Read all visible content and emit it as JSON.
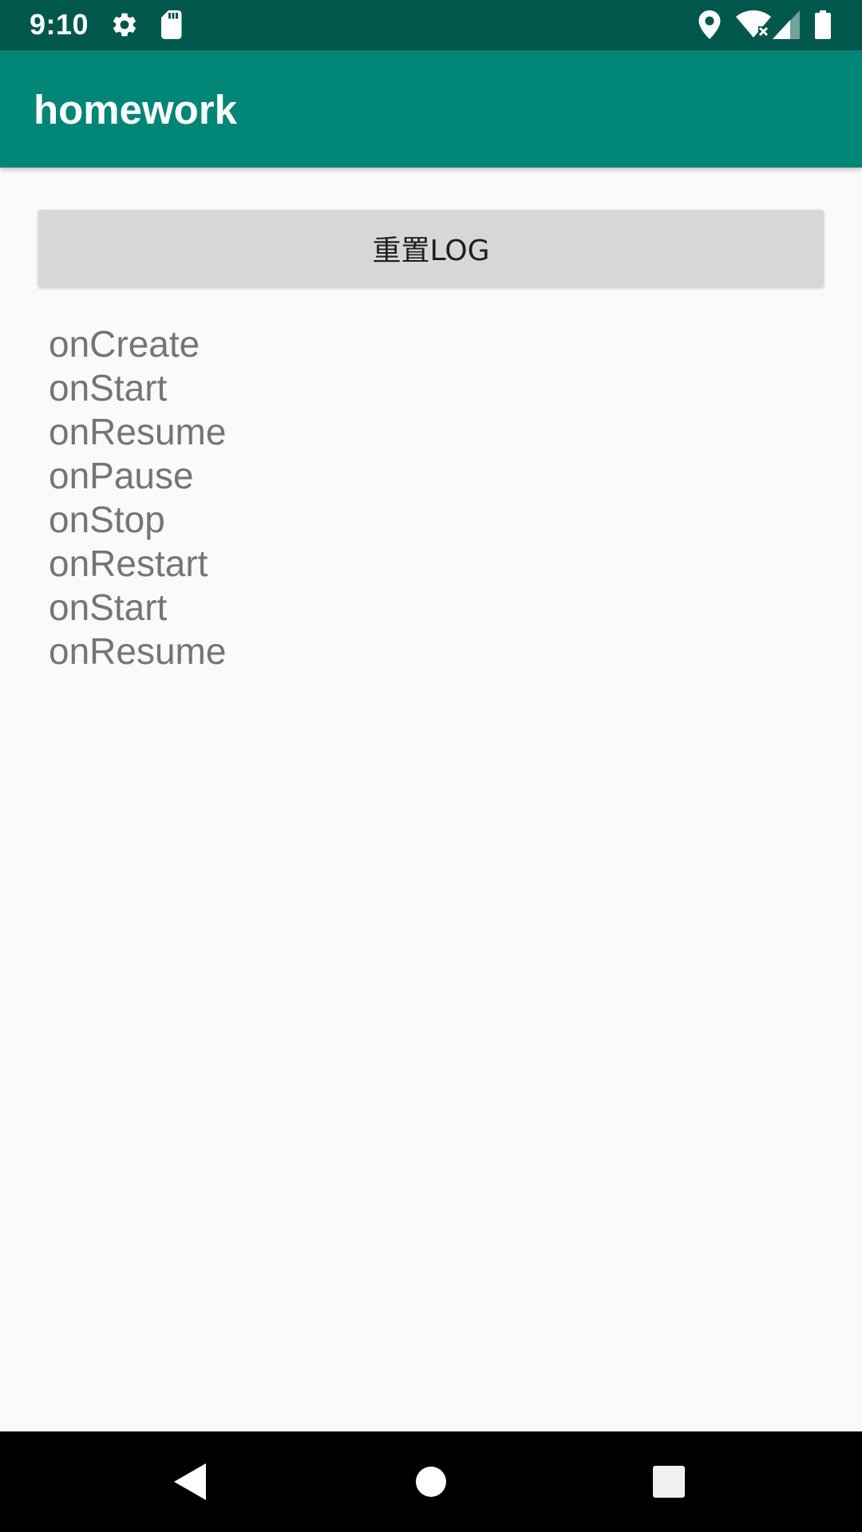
{
  "status_bar": {
    "time": "9:10",
    "icons": [
      "settings-icon",
      "sd-card-icon",
      "location-icon",
      "wifi-icon",
      "cell-signal-icon",
      "battery-icon"
    ]
  },
  "app_bar": {
    "title": "homework"
  },
  "main": {
    "reset_button_label": "重置LOG",
    "log_lines": [
      "onCreate",
      "onStart",
      "onResume",
      "onPause",
      "onStop",
      "onRestart",
      "onStart",
      "onResume"
    ]
  },
  "nav_bar": {
    "buttons": [
      "back-icon",
      "home-icon",
      "recents-icon"
    ]
  },
  "colors": {
    "status_bar": "#00574b",
    "app_bar": "#008577",
    "background": "#fafafa",
    "button": "#d6d7d7",
    "log_text": "#757575",
    "nav_bar": "#000000"
  }
}
